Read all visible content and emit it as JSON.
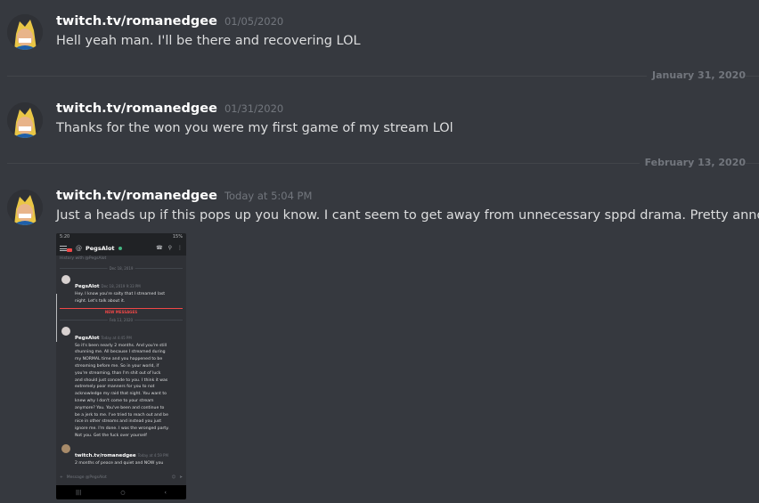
{
  "messages": [
    {
      "username": "twitch.tv/romanedgee",
      "timestamp": "01/05/2020",
      "text": "Hell yeah man. I'll be there and recovering LOL"
    },
    {
      "username": "twitch.tv/romanedgee",
      "timestamp": "01/31/2020",
      "text": "Thanks for the won you were my first game of my stream LOl"
    },
    {
      "username": "twitch.tv/romanedgee",
      "timestamp": "Today at 5:04 PM",
      "text": "Just a heads up if this pops up you know. I cant seem to get away from unnecessary sppd drama. Pretty annoying."
    }
  ],
  "dividers": [
    "January 31, 2020",
    "February 13, 2020"
  ],
  "attachment": {
    "status_time": "5:20",
    "status_right": "15%",
    "channel": "PegsAlot",
    "history_text": "History with @PegsAlot",
    "divider1": "Dec 18, 2019",
    "msg1_user": "PegsAlot",
    "msg1_time": "Dec 18, 2019 9:33 PM",
    "msg1_text": "Hey. I know you're salty that I streamed last\nnight. Let's talk about it.",
    "new_messages": "NEW MESSAGES",
    "divider2": "Feb 13, 2020",
    "msg2_user": "PegsAlot",
    "msg2_time": "Today at 4:45 PM",
    "msg2_text": "So it's been nearly 2 months. And you're still\nshunning me. All because I streamed during\nmy NORMAL time and you happened to be\nstreaming before me. So in your world, if\nyou're streaming, than I'm shit out of luck\nand should just concede to you. I think it was\nextremely poor manners for you to not\nacknowledge my raid that night. You want to\nknew why I don't come to your stream\nanymore? You. You've been and continue to\nbe a jerk to me. I've tried to reach out and be\nnice in other streams and instead you just\nignore me. I'm done. I was the wronged party.\nNot you. Get the fuck over yourself",
    "msg3_user": "twitch.tv/romanedgee",
    "msg3_time": "Today at 4:59 PM",
    "msg3_text": "2 months of peace and quiet and NOW you",
    "input_placeholder": "Message @PegsAlot"
  },
  "colors": {
    "background": "#36393f",
    "username": "#ffffff",
    "text": "#dcddde",
    "muted": "#72767d",
    "online": "#43b581",
    "new": "#f04747"
  },
  "icons": [
    "avatar",
    "hamburger-icon",
    "phone-icon",
    "search-icon",
    "more-icon",
    "plus-icon",
    "emoji-icon",
    "send-icon",
    "back-icon",
    "home-icon",
    "recents-icon"
  ]
}
